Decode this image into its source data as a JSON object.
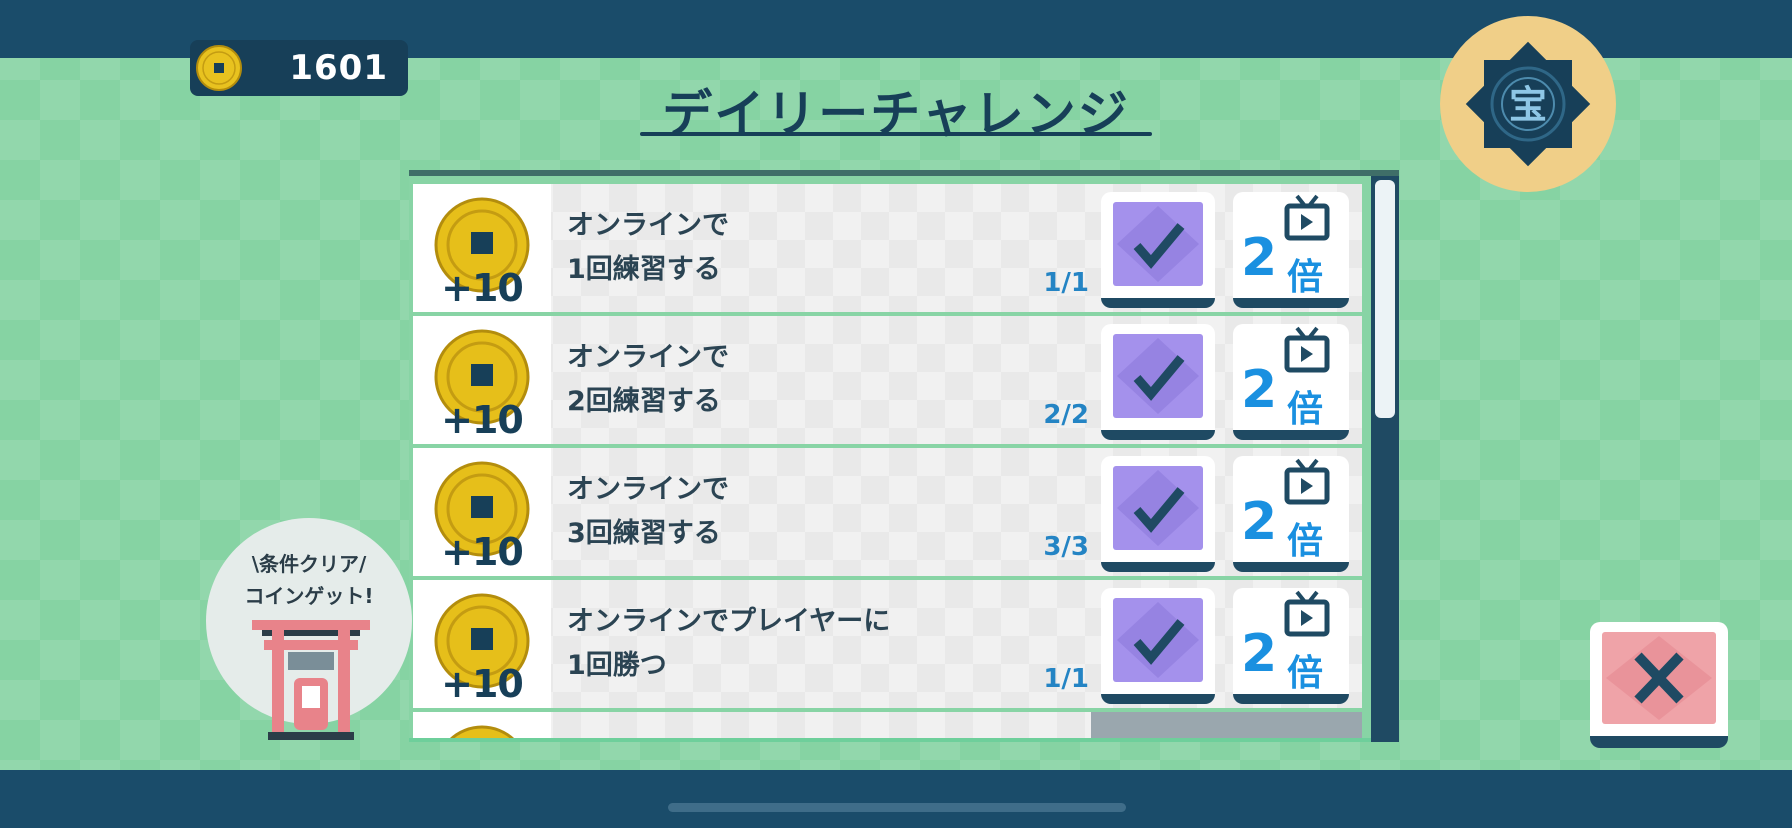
{
  "currency": {
    "coins": "1601",
    "icon": "gold-coin-icon"
  },
  "title": "デイリーチャレンジ",
  "treasure_button": {
    "icon": "treasure-emblem-icon",
    "glyph": "宝"
  },
  "missions": [
    {
      "reward": "+10",
      "text_line1": "オンラインで",
      "text_line2": "1回練習する",
      "progress": "1/1",
      "claim_icon": "checkmark-icon",
      "double_label": "2",
      "double_sub": "倍"
    },
    {
      "reward": "+10",
      "text_line1": "オンラインで",
      "text_line2": "2回練習する",
      "progress": "2/2",
      "claim_icon": "checkmark-icon",
      "double_label": "2",
      "double_sub": "倍"
    },
    {
      "reward": "+10",
      "text_line1": "オンラインで",
      "text_line2": "3回練習する",
      "progress": "3/3",
      "claim_icon": "checkmark-icon",
      "double_label": "2",
      "double_sub": "倍"
    },
    {
      "reward": "+10",
      "text_line1": "オンラインでプレイヤーに",
      "text_line2": "1回勝つ",
      "progress": "1/1",
      "claim_icon": "checkmark-icon",
      "double_label": "2",
      "double_sub": "倍"
    }
  ],
  "info_bubble": {
    "line1": "\\条件クリア/",
    "line2": "コインゲット!",
    "icon": "torii-gate-icon"
  },
  "close_button": {
    "icon": "close-icon"
  },
  "colors": {
    "accent": "#173f58",
    "background": "#86d3a3",
    "claim": "#a491ec",
    "double": "#1a90e0",
    "close": "#efa3a8",
    "progress": "#2484c4"
  }
}
